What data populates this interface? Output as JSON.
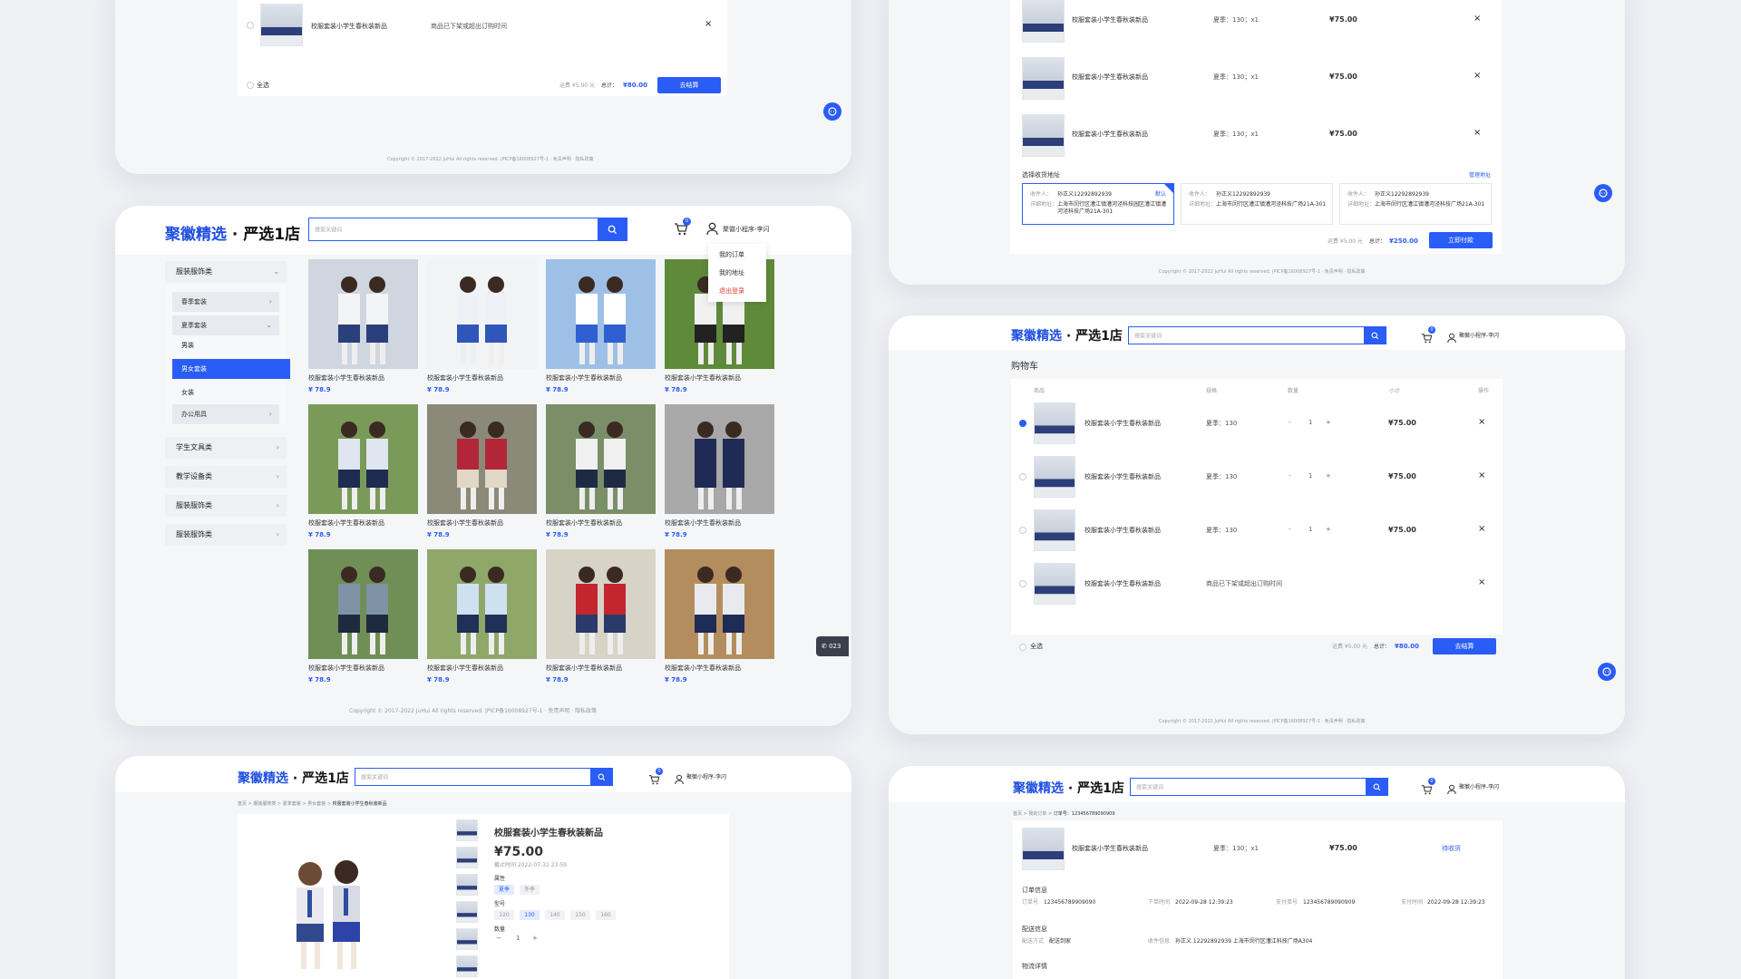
{
  "brand": {
    "name_a": "聚徽精选",
    "dot": "·",
    "name_b": "严选1店"
  },
  "search": {
    "placeholder": "搜索关键词"
  },
  "header": {
    "cart_badge": "0",
    "user": "聚徽小程序-李闪"
  },
  "user_menu": [
    "我的订单",
    "我的地址",
    "退出登录"
  ],
  "product_name": "校服套装小学生春秋装新品",
  "offline_text": "商品已下架或超出订购时间",
  "footer": "Copyright © 2017-2022 JuHui All rights reserved. |PICP备16008927号-1 · 免责声明 · 隐私政策",
  "panel1": {
    "select_all": "全选",
    "shipping": "运费 ¥5.00 元",
    "total_label": "总计：",
    "total": "¥80.00",
    "checkout": "去结算"
  },
  "panel2": {
    "spec": "夏季：130；x1",
    "price": "¥75.00",
    "address_title": "选择收货地址",
    "manage": "管理地址",
    "addr_labels": {
      "name": "收件人：",
      "detail": "详细地址："
    },
    "addresses": [
      {
        "name": "孙正义12292892939",
        "detail": "上海市闵行区漕江镇漕河泾科技园区漕江镇漕河泾科技广场21A-301",
        "default": "默认"
      },
      {
        "name": "孙正义12292892939",
        "detail": "上海市闵行区漕江镇漕河泾科技广场21A-301"
      },
      {
        "name": "孙正义12292892939",
        "detail": "上海市闵行区漕江镇漕河泾科技广场21A-301"
      }
    ],
    "shipping": "运费 ¥5.00 元",
    "total_label": "总计：",
    "total": "¥250.00",
    "pay": "立即付款"
  },
  "panel3": {
    "sidebar": {
      "top": "服装服饰类",
      "sub": [
        "春季套装",
        "夏季套装"
      ],
      "leaves": [
        "男装",
        "男女套装",
        "女装"
      ],
      "office": "办公用具",
      "more": [
        "学生文具类",
        "教学设备类",
        "服装服饰类",
        "服装服饰类"
      ]
    },
    "price": "¥ 78.9",
    "phone": "023"
  },
  "panel4": {
    "title": "购物车",
    "cols": [
      "商品",
      "规格",
      "数量",
      "小计",
      "操作"
    ],
    "spec": "夏季：130",
    "qty_minus": "-",
    "qty": "1",
    "qty_plus": "+",
    "price": "¥75.00",
    "select_all": "全选",
    "shipping": "运费 ¥5.00 元",
    "total_label": "总计：",
    "total": "¥80.00",
    "checkout": "去结算"
  },
  "panel5": {
    "breadcrumb": [
      "首页",
      "服装服饰类",
      "夏季套装",
      "男女套装",
      "校服套装小学生春秋装新品"
    ],
    "title": "校服套装小学生春秋装新品",
    "price": "¥75.00",
    "deadline": "截止时间 2022-07-31 23:59",
    "attr_label": "属性",
    "seasons": [
      "夏季",
      "冬季"
    ],
    "size_label": "型号",
    "sizes": [
      "120",
      "130",
      "140",
      "150",
      "160"
    ],
    "qty_label": "数量",
    "qty": "1"
  },
  "panel6": {
    "breadcrumb": [
      "首页",
      "我的订单",
      "订单号：123456789090909"
    ],
    "spec": "夏季：130；x1",
    "price": "¥75.00",
    "status": "待收货",
    "order_info_title": "订单信息",
    "order_no_label": "订单号",
    "order_no": "123456789909090",
    "order_time_label": "下单时间",
    "order_time": "2022-09-28 12:39:23",
    "pay_no_label": "支付单号",
    "pay_no": "123456789090909",
    "pay_time_label": "支付时间",
    "pay_time": "2022-09-28 12:39:23",
    "delivery_title": "配送信息",
    "delivery_method_label": "配送方式",
    "delivery_method": "配送到家",
    "receiver_label": "收件信息",
    "receiver": "孙正义 12292892939 上海市闵行区漕江科技广场A304",
    "logistics_title": "物流详情"
  },
  "colors": {
    "accent": "#2a5cf6",
    "red": "#e53935",
    "bg": "#eef0f4"
  }
}
